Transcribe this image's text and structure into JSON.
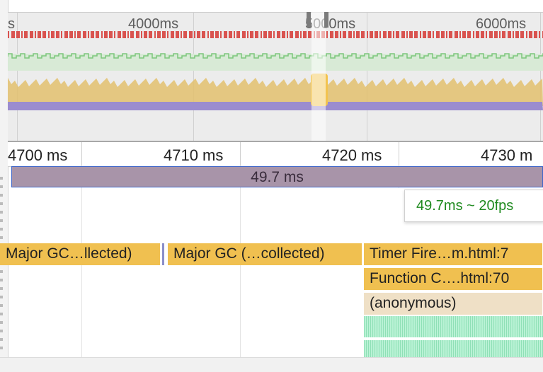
{
  "overview": {
    "tick_labels": [
      "s",
      "4000ms",
      "5000ms",
      "6000ms"
    ],
    "colors": {
      "frames_red": "#d9534f",
      "fps_green": "#7cc67c",
      "scripting_yellow": "#e3c16f",
      "rendering_purple": "#9b8ccf",
      "selection": "#f2c34f"
    }
  },
  "ruler": {
    "labels": [
      "4700 ms",
      "4710 ms",
      "4720 ms",
      "4730 m"
    ]
  },
  "frame": {
    "duration_label": "49.7 ms"
  },
  "tooltip": {
    "text": "49.7ms ~ 20fps"
  },
  "flame_chart": {
    "entries": [
      {
        "label": "Major GC…llected)",
        "kind": "gc"
      },
      {
        "label": "Major GC (…collected)",
        "kind": "gc"
      },
      {
        "label": "Timer Fire…m.html:7",
        "kind": "script"
      },
      {
        "label": "Function C….html:70",
        "kind": "script"
      },
      {
        "label": "(anonymous)",
        "kind": "anonymous"
      }
    ]
  }
}
